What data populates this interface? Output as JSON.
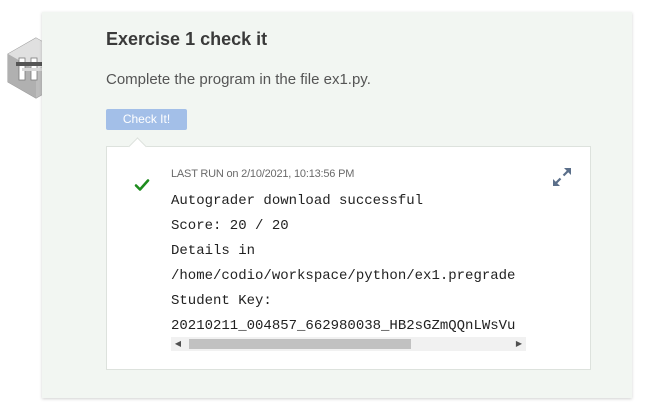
{
  "exercise": {
    "title": "Exercise 1 check it",
    "description": "Complete the program in the file ex1.py.",
    "check_button_label": "Check It!",
    "icon": "hexagon-turnstile-icon"
  },
  "result": {
    "status_icon": "checkmark-icon",
    "status_color": "#1e8c1e",
    "last_run_label": "LAST RUN",
    "last_run_on": "on 2/10/2021, 10:13:56 PM",
    "expand_icon": "expand-arrows-icon",
    "output_lines": [
      "Autograder download successful",
      "Score: 20 / 20",
      "Details in",
      "/home/codio/workspace/python/ex1.pregrade",
      "Student Key:",
      "20210211_004857_662980038_HB2sGZmQQnLWsVu"
    ],
    "scrollbar": {
      "left_arrow": "◀",
      "right_arrow": "▶"
    }
  },
  "colors": {
    "card_bg": "#f2f6f2",
    "button_bg": "#a3bfe8",
    "expand_icon": "#5b6f8a"
  }
}
